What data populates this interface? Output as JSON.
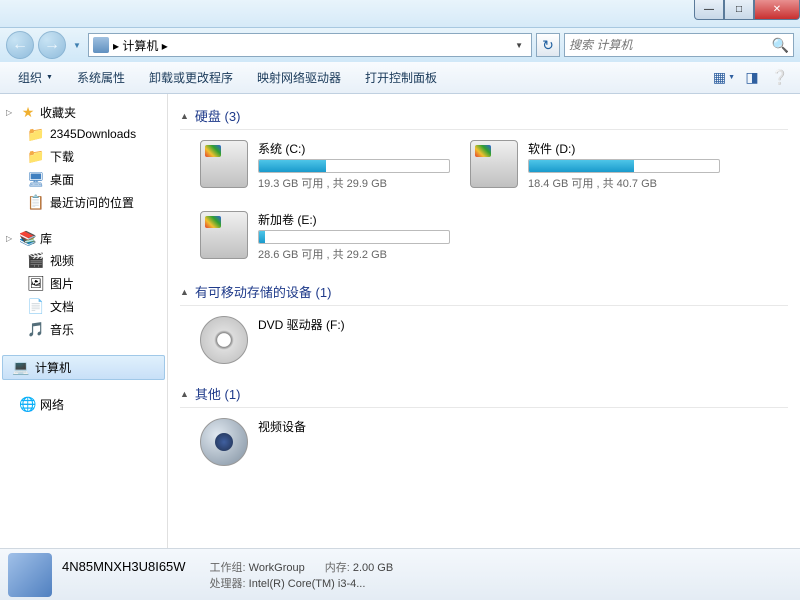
{
  "titlebar": {
    "min": "—",
    "max": "□",
    "close": "✕"
  },
  "nav": {
    "back": "←",
    "forward": "→"
  },
  "address": {
    "path": "▸ 计算机 ▸",
    "refresh": "↻"
  },
  "search": {
    "placeholder": "搜索 计算机",
    "icon": "🔍"
  },
  "toolbar": {
    "organize": "组织",
    "system_props": "系统属性",
    "uninstall": "卸载或更改程序",
    "map_drive": "映射网络驱动器",
    "control_panel": "打开控制面板"
  },
  "sidebar": {
    "favorites": {
      "label": "收藏夹",
      "items": [
        "2345Downloads",
        "下载",
        "桌面",
        "最近访问的位置"
      ]
    },
    "libraries": {
      "label": "库",
      "items": [
        "视频",
        "图片",
        "文档",
        "音乐"
      ]
    },
    "computer": {
      "label": "计算机"
    },
    "network": {
      "label": "网络"
    }
  },
  "sections": {
    "hdd": {
      "label": "硬盘 (3)"
    },
    "removable": {
      "label": "有可移动存储的设备 (1)"
    },
    "other": {
      "label": "其他 (1)"
    }
  },
  "drives": [
    {
      "name": "系统 (C:)",
      "status": "19.3 GB 可用 , 共 29.9 GB",
      "fillPct": 35
    },
    {
      "name": "软件 (D:)",
      "status": "18.4 GB 可用 , 共 40.7 GB",
      "fillPct": 55
    },
    {
      "name": "新加卷 (E:)",
      "status": "28.6 GB 可用 , 共 29.2 GB",
      "fillPct": 3
    }
  ],
  "removable_drive": {
    "name": "DVD 驱动器 (F:)"
  },
  "other_device": {
    "name": "视频设备"
  },
  "status": {
    "computer_name": "4N85MNXH3U8I65W",
    "workgroup_label": "工作组:",
    "workgroup": "WorkGroup",
    "memory_label": "内存:",
    "memory": "2.00 GB",
    "cpu_label": "处理器:",
    "cpu": "Intel(R) Core(TM) i3-4..."
  }
}
